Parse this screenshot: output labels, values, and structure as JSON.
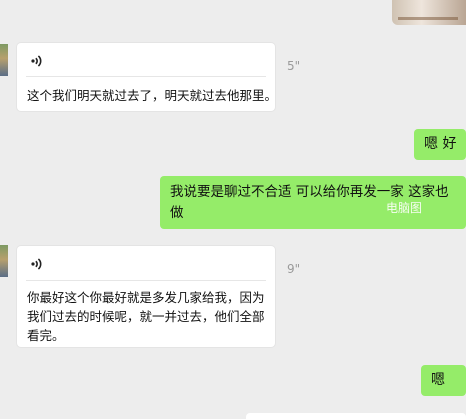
{
  "messages": [
    {
      "side": "in",
      "type": "voice",
      "duration": "5\"",
      "transcript": "这个我们明天就过去了，明天就过去他那里。"
    },
    {
      "side": "out",
      "type": "text",
      "text": "嗯 好"
    },
    {
      "side": "out",
      "type": "text",
      "text": "我说要是聊过不合适  可以给你再发一家   这家也做"
    },
    {
      "side": "in",
      "type": "voice",
      "duration": "9\"",
      "transcript": "你最好这个你最好就是多发几家给我，因为我们过去的时候呢，就一并过去，他们全部看完。"
    },
    {
      "side": "out",
      "type": "text",
      "text": "嗯"
    }
  ],
  "watermark": "电脑图",
  "colors": {
    "background": "#ededed",
    "incoming_bubble": "#ffffff",
    "outgoing_bubble": "#95ec69",
    "duration_text": "#9a9a9a"
  },
  "icons": {
    "voice": "voice-wave-icon"
  }
}
